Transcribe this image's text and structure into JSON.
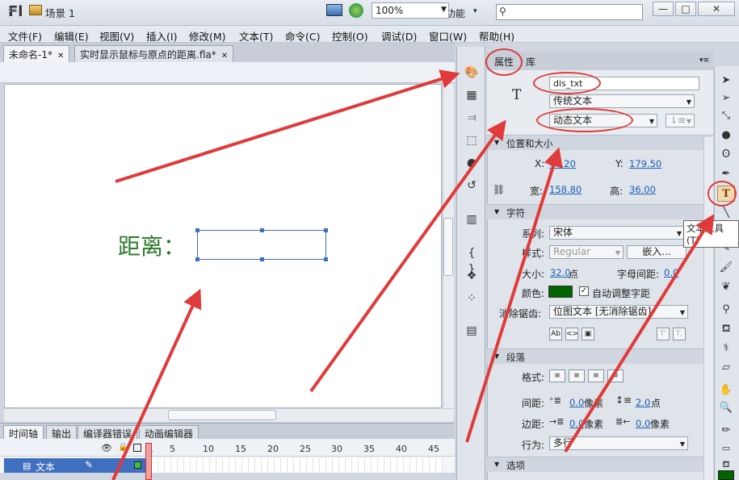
{
  "app": {
    "logo": "Fl",
    "workspace": "基本功能",
    "search_placeholder": ""
  },
  "window_controls": {
    "minimize": "—",
    "maximize": "□",
    "close": "✕"
  },
  "menu": [
    "文件(F)",
    "编辑(E)",
    "视图(V)",
    "插入(I)",
    "修改(M)",
    "文本(T)",
    "命令(C)",
    "控制(O)",
    "调试(D)",
    "窗口(W)",
    "帮助(H)"
  ],
  "doc_tabs": [
    {
      "label": "未命名-1*"
    },
    {
      "label": "实时显示鼠标与原点的距离.fla*"
    }
  ],
  "scene": {
    "label": "场景 1",
    "zoom": "100%"
  },
  "stage": {
    "label": "距离："
  },
  "timeline": {
    "tabs": [
      "时间轴",
      "输出",
      "编译器错误",
      "动画编辑器"
    ],
    "frame_numbers": [
      "1",
      "5",
      "10",
      "15",
      "20",
      "25",
      "30",
      "35",
      "40",
      "45"
    ],
    "layer_name": "文本"
  },
  "properties": {
    "tabs": [
      "属性",
      "库"
    ],
    "instance_name": "dis_txt",
    "text_engine": "传统文本",
    "text_type": "动态文本",
    "sections": {
      "position": "位置和大小",
      "character": "字符",
      "paragraph": "段落",
      "options": "选项"
    },
    "position": {
      "x_label": "X:",
      "x_value": "44.20",
      "y_label": "Y:",
      "y_value": "179.50",
      "w_label": "宽:",
      "w_value": "158.80",
      "h_label": "高:",
      "h_value": "36.00"
    },
    "character": {
      "family_label": "系列:",
      "family_value": "宋体",
      "style_label": "样式:",
      "style_value": "Regular",
      "embed_button": "嵌入...",
      "size_label": "大小:",
      "size_value": "32.0",
      "size_unit": "点",
      "spacing_label": "字母间距:",
      "spacing_value": "0.0",
      "color_label": "颜色:",
      "color_value": "#006400",
      "autokern_label": "自动调整字距",
      "antialias_label": "消除锯齿:",
      "antialias_value": "位图文本 [无消除锯齿]"
    },
    "paragraph": {
      "format_label": "格式:",
      "spacing_label": "间距:",
      "indent_value": "0.0",
      "indent_unit": "像素",
      "line_value": "2.0",
      "line_unit": "点",
      "margin_label": "边距:",
      "left_margin": "0.0",
      "left_unit": "像素",
      "right_margin": "0.0",
      "right_unit": "像素",
      "behavior_label": "行为:",
      "behavior_value": "多行"
    }
  },
  "tooltip": "文本工具(T)",
  "annotation_color": "#e03a3a"
}
